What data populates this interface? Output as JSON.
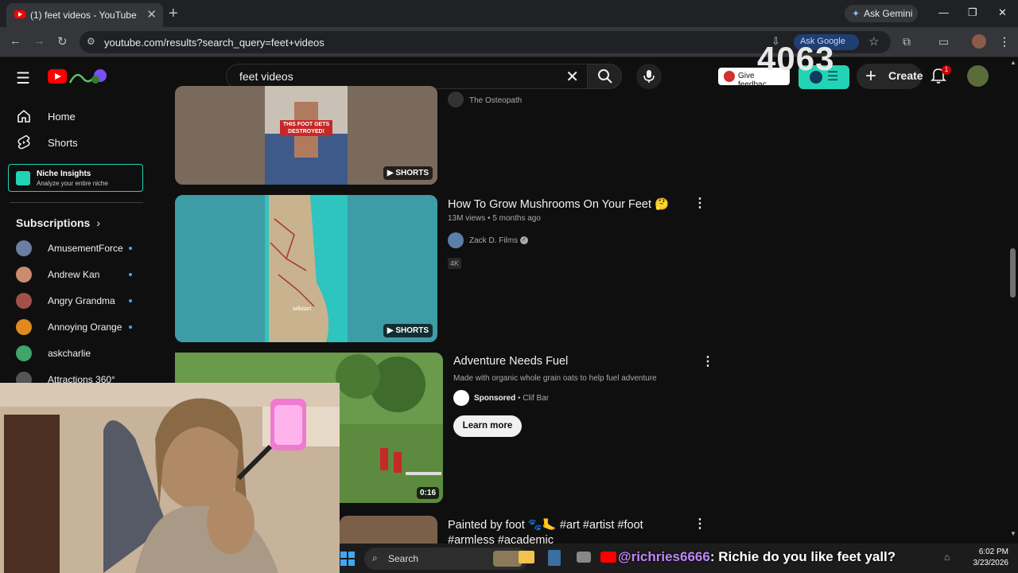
{
  "browser": {
    "tab_title": "(1) feet videos - YouTube",
    "ask_gemini": "Ask Gemini",
    "url": "youtube.com/results?search_query=feet+videos",
    "ask_google": "Ask Google"
  },
  "header": {
    "search_query": "feet videos",
    "give_feedback": "Give feedbac...",
    "create_label": "Create",
    "notification_count": "1",
    "view_counter_overlay": "4063"
  },
  "sidebar": {
    "nav": [
      {
        "label": "Home"
      },
      {
        "label": "Shorts"
      }
    ],
    "niche_title": "Niche Insights",
    "niche_subtitle": "Analyze your entire niche",
    "subscriptions_label": "Subscriptions",
    "subscriptions": [
      {
        "name": "AmusementForce"
      },
      {
        "name": "Andrew Kan"
      },
      {
        "name": "Angry Grandma"
      },
      {
        "name": "Annoying Orange"
      },
      {
        "name": "askcharlie"
      },
      {
        "name": "Attractions 360°"
      }
    ]
  },
  "results": [
    {
      "channel": "The Osteopath",
      "thumb_text": "THIS FOOT GETS DESTROYED!",
      "badge": "SHORTS"
    },
    {
      "title": "How To Grow Mushrooms On Your Feet 🤔",
      "views": "13M views",
      "age": "5 months ago",
      "channel": "Zack D. Films",
      "tag": "4K",
      "badge": "SHORTS",
      "thumb_text": "willstart"
    },
    {
      "title": "Adventure Needs Fuel",
      "description": "Made with organic whole grain oats to help fuel adventure",
      "sponsored": "Sponsored",
      "advertiser": "Clif Bar",
      "cta": "Learn more",
      "duration": "0:16"
    },
    {
      "title": "Painted by foot 🐾🦶 #art #artist #foot",
      "title_line2": "#armless #academic"
    }
  ],
  "taskbar": {
    "search_label": "Search",
    "chat_user": "@richries6666",
    "chat_message": ": Richie do you like feet yall?",
    "time": "6:02 PM",
    "date": "3/23/2026"
  },
  "colors": {
    "youtube_red": "#ff0000",
    "tubebuddy_teal": "#22d3b5",
    "background": "#0f0f0f"
  }
}
